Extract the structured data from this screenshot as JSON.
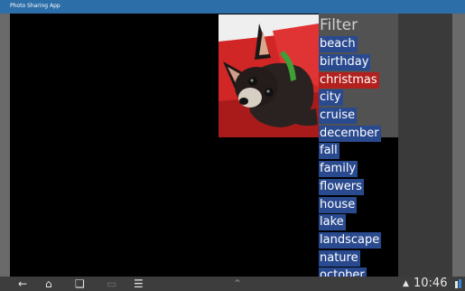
{
  "app": {
    "title": "Photo Sharing App"
  },
  "filter": {
    "title": "Filter",
    "tags": [
      {
        "label": "beach",
        "selected": false
      },
      {
        "label": "birthday",
        "selected": false
      },
      {
        "label": "christmas",
        "selected": true
      },
      {
        "label": "city",
        "selected": false
      },
      {
        "label": "cruise",
        "selected": false
      },
      {
        "label": "december",
        "selected": false
      },
      {
        "label": "fall",
        "selected": false
      },
      {
        "label": "family",
        "selected": false
      },
      {
        "label": "flowers",
        "selected": false
      },
      {
        "label": "house",
        "selected": false
      },
      {
        "label": "lake",
        "selected": false
      },
      {
        "label": "landscape",
        "selected": false
      },
      {
        "label": "nature",
        "selected": false
      },
      {
        "label": "october",
        "selected": false
      }
    ]
  },
  "photo": {
    "subject": "dog-photo"
  },
  "system_bar": {
    "time": "10:46"
  },
  "icons": {
    "back": "back-icon",
    "home": "home-icon",
    "recent": "recent-apps-icon",
    "menu": "menu-icon"
  },
  "colors": {
    "tag_bg": "#2a4a8f",
    "tag_selected_bg": "#b3211e",
    "title_bar": "#2c6ea8"
  }
}
